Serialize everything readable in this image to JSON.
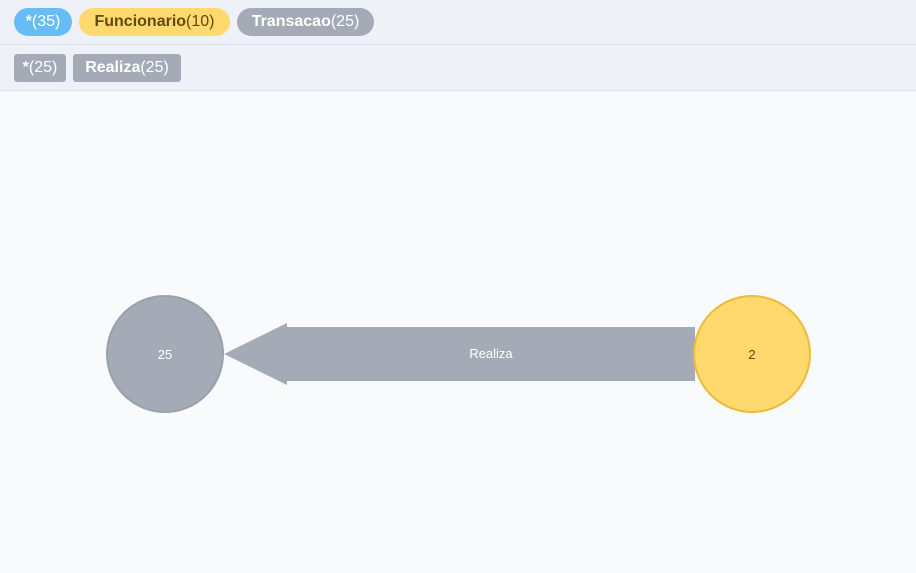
{
  "label_pills": {
    "all": {
      "name": "*",
      "count": "(35)"
    },
    "funcionario": {
      "name": "Funcionario",
      "count": "(10)"
    },
    "transacao": {
      "name": "Transacao",
      "count": "(25)"
    }
  },
  "rel_type_tags": {
    "all": {
      "name": "*",
      "count": "(25)"
    },
    "realiza": {
      "name": "Realiza",
      "count": "(25)"
    }
  },
  "graph": {
    "nodes": [
      {
        "label": "Transacao",
        "caption": "25",
        "color": "#a5abb6",
        "border": "#9aa1ac"
      },
      {
        "label": "Funcionario",
        "caption": "2",
        "color": "#ffd86e",
        "border": "#edba39"
      }
    ],
    "relationship": {
      "type": "Realiza",
      "color": "#a5abb6"
    }
  },
  "colors": {
    "toolbar_bg": "#eef1f8",
    "canvas_bg": "#f9fafb",
    "node_all": "#68bdf6",
    "node_funcionario": "#ffd86e",
    "node_transacao": "#a5abb6"
  }
}
